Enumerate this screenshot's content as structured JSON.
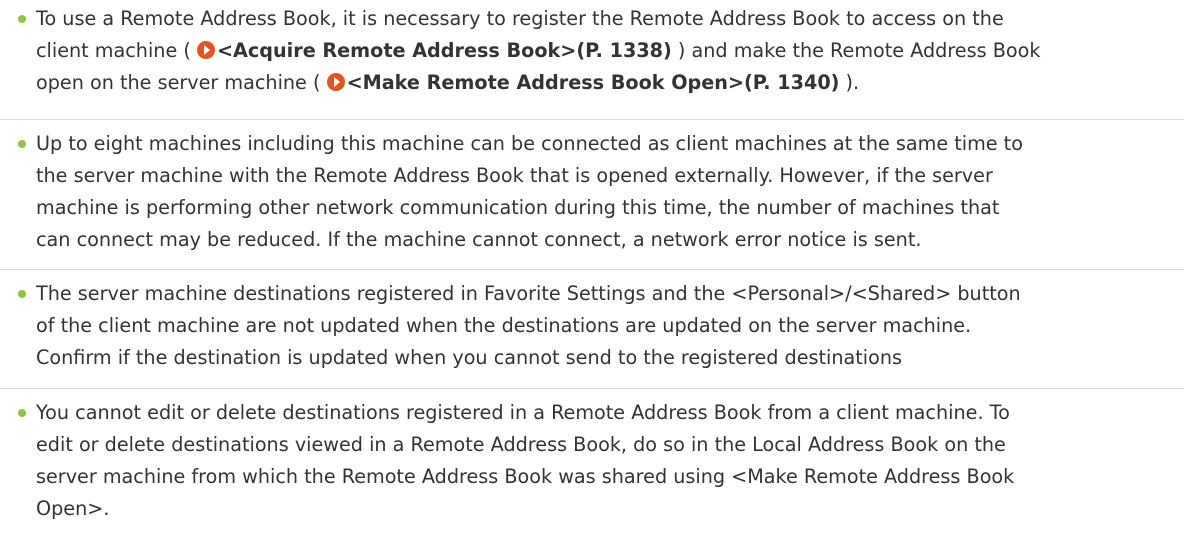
{
  "items": [
    {
      "lines": [
        {
          "pre": "To use a Remote Address Book, it is necessary to register the Remote Address Book to access on the"
        },
        {
          "pre": "client machine ( ",
          "link": "<Acquire Remote Address Book>(P. 1338)",
          "post": " ) and make the Remote Address Book"
        },
        {
          "pre": "open on the server machine ( ",
          "link": "<Make Remote Address Book Open>(P. 1340)",
          "post": " )."
        }
      ]
    },
    {
      "lines": [
        {
          "pre": "Up to eight machines including this machine can be connected as client machines at the same time to"
        },
        {
          "pre": "the server machine with the Remote Address Book that is opened externally. However, if the server"
        },
        {
          "pre": "machine is performing other network communication during this time, the number of machines that"
        },
        {
          "pre": "can connect may be reduced. If the machine cannot connect, a network error notice is sent."
        }
      ]
    },
    {
      "lines": [
        {
          "pre": "The server machine destinations registered in Favorite Settings and the <Personal>/<Shared> button"
        },
        {
          "pre": "of the client machine are not updated when the destinations are updated on the server machine."
        },
        {
          "pre": "Confirm if the destination is updated when you cannot send to the registered destinations"
        }
      ]
    },
    {
      "lines": [
        {
          "pre": "You cannot edit or delete destinations registered in a Remote Address Book from a client machine. To"
        },
        {
          "pre": "edit or delete destinations viewed in a Remote Address Book, do so in the Local Address Book on the"
        },
        {
          "pre": "server machine from which the Remote Address Book was shared using <Make Remote Address Book"
        },
        {
          "pre": "Open>."
        }
      ]
    }
  ],
  "colors": {
    "bullet": "#8cc63f",
    "link_icon": "#e8531f",
    "text": "#333333",
    "divider": "#d9d9d9"
  },
  "icons": {
    "bullet": "bullet-dot-icon",
    "link": "arrow-circle-right-icon"
  }
}
